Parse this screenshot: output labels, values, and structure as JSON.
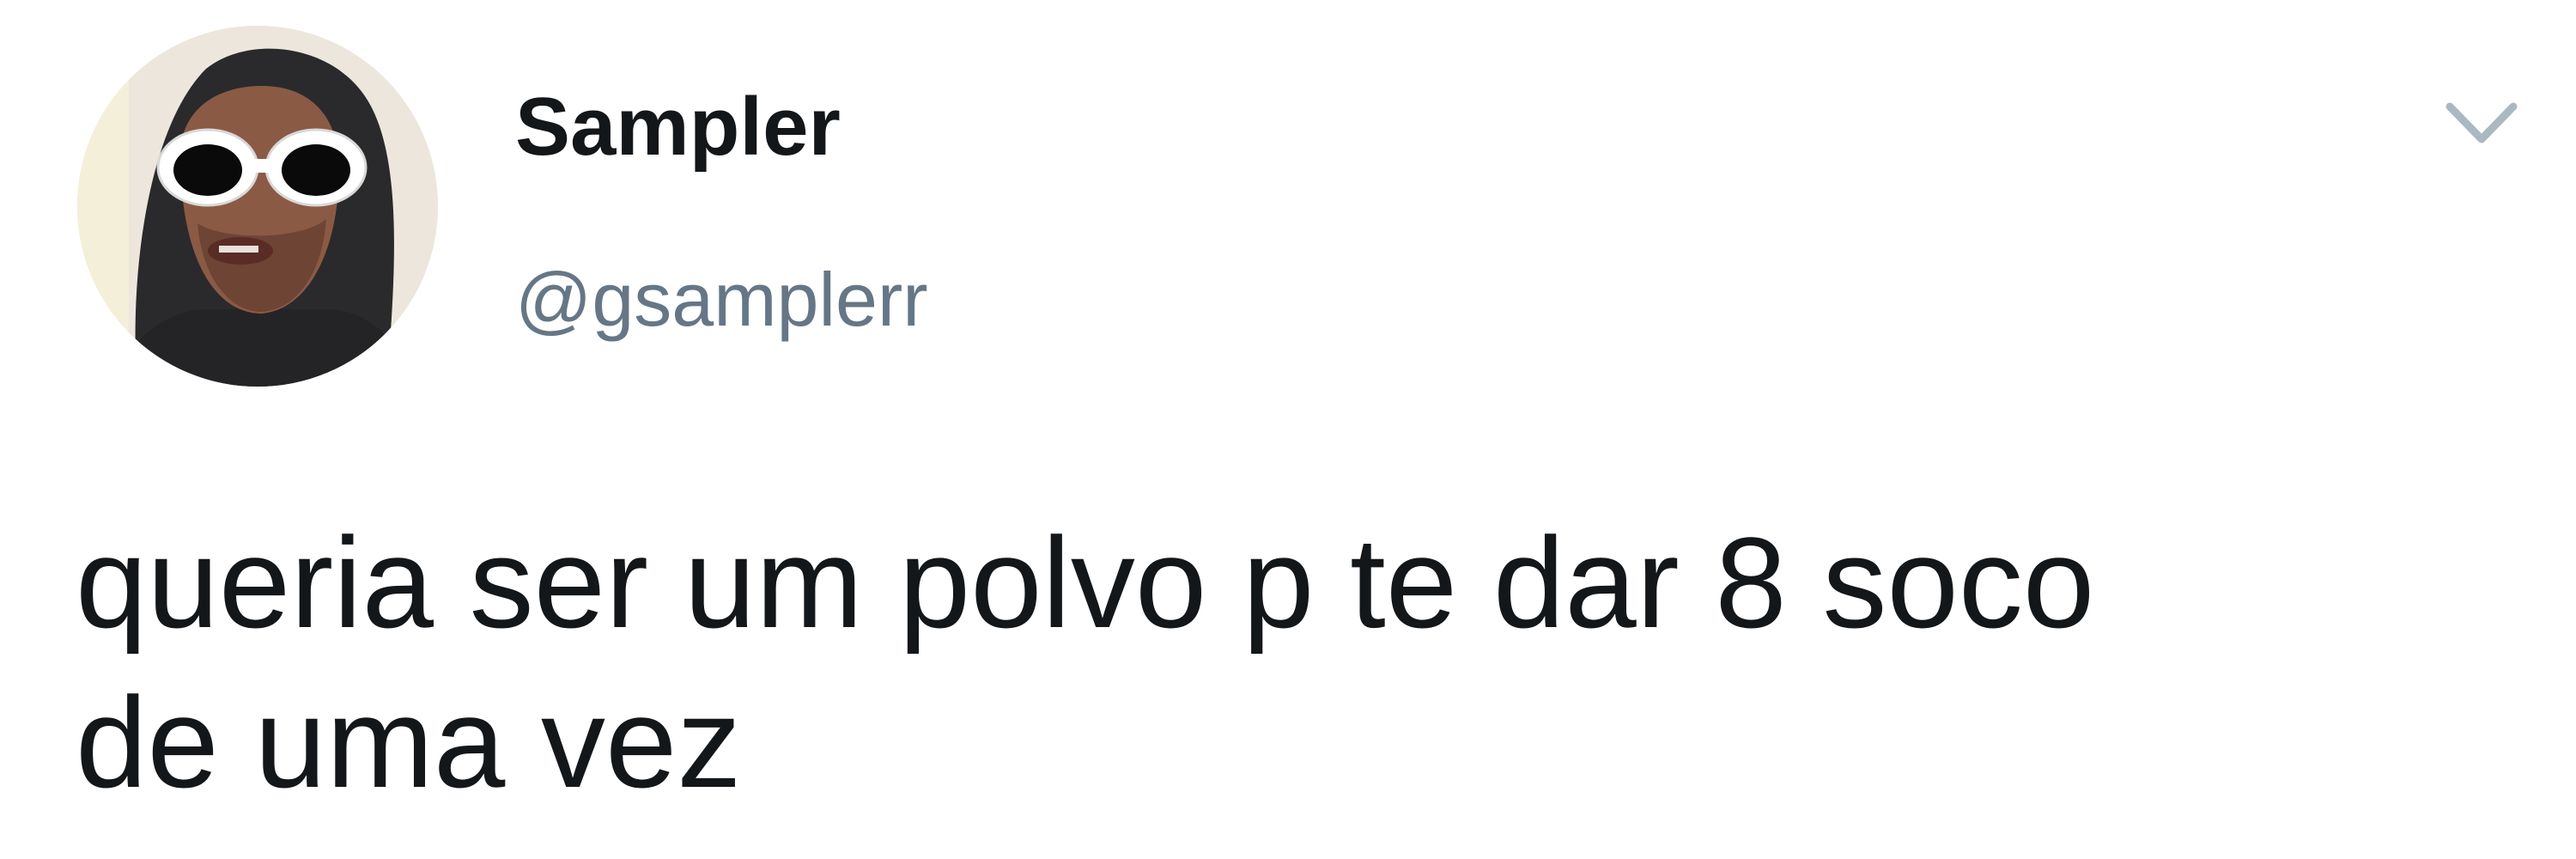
{
  "tweet": {
    "author": {
      "display_name": "Sampler",
      "handle": "@gsamplerr",
      "avatar_icon": "user-avatar-photo"
    },
    "menu_icon": "chevron-down-icon",
    "text": "queria ser um polvo p te dar 8 soco\nde uma vez"
  },
  "colors": {
    "text_primary": "#14171a",
    "text_secondary": "#657786",
    "chevron": "#aab8c2",
    "background": "#ffffff"
  }
}
